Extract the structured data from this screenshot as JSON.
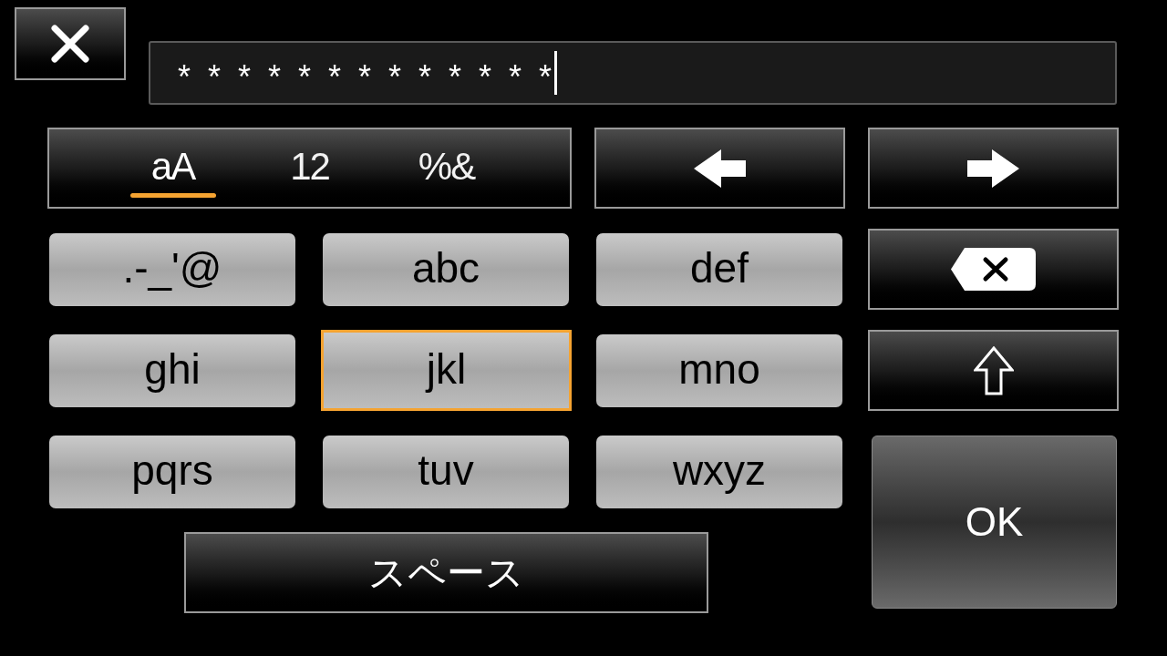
{
  "input_field": {
    "value": "*************",
    "focused": true
  },
  "mode_tabs": [
    {
      "label": "aA",
      "selected": true
    },
    {
      "label": "12",
      "selected": false
    },
    {
      "label": "%&",
      "selected": false
    }
  ],
  "keys": [
    {
      "label": ".-_'@",
      "selected": false
    },
    {
      "label": "abc",
      "selected": false
    },
    {
      "label": "def",
      "selected": false
    },
    {
      "label": "ghi",
      "selected": false
    },
    {
      "label": "jkl",
      "selected": true
    },
    {
      "label": "mno",
      "selected": false
    },
    {
      "label": "pqrs",
      "selected": false
    },
    {
      "label": "tuv",
      "selected": false
    },
    {
      "label": "wxyz",
      "selected": false
    }
  ],
  "space_button": {
    "label": "スペース"
  },
  "ok_button": {
    "label": "OK"
  }
}
